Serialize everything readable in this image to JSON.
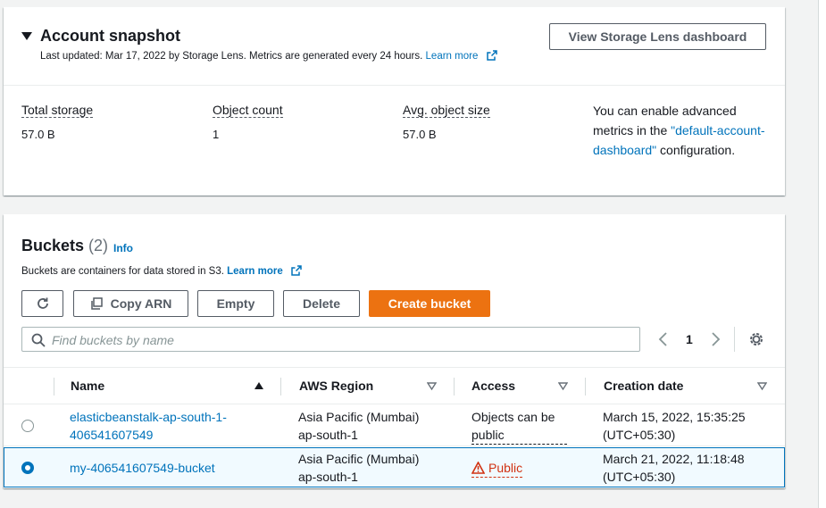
{
  "snapshot": {
    "title": "Account snapshot",
    "subtitle_prefix": "Last updated: Mar 17, 2022 by Storage Lens. Metrics are generated every 24 hours.",
    "learn_more": "Learn more",
    "dashboard_button": "View Storage Lens dashboard",
    "metrics": [
      {
        "label": "Total storage",
        "value": "57.0 B"
      },
      {
        "label": "Object count",
        "value": "1"
      },
      {
        "label": "Avg. object size",
        "value": "57.0 B"
      }
    ],
    "advanced_text_1": "You can enable advanced metrics in the",
    "advanced_link": "\"default-account-dashboard\"",
    "advanced_text_2": "configuration."
  },
  "buckets": {
    "title": "Buckets",
    "count": "(2)",
    "info": "Info",
    "subtitle": "Buckets are containers for data stored in S3.",
    "learn_more": "Learn more",
    "buttons": {
      "copy_arn": "Copy ARN",
      "empty": "Empty",
      "delete": "Delete",
      "create": "Create bucket"
    },
    "search_placeholder": "Find buckets by name",
    "page": "1",
    "columns": [
      "Name",
      "AWS Region",
      "Access",
      "Creation date"
    ],
    "rows": [
      {
        "name_line1": "elasticbeanstalk-ap-south-1-",
        "name_line2": "406541607549",
        "region_line1": "Asia Pacific (Mumbai)",
        "region_line2": "ap-south-1",
        "access_line1": "Objects can be",
        "access_line2": "public",
        "date_line1": "March 15, 2022, 15:35:25",
        "date_line2": "(UTC+05:30)",
        "selected": false
      },
      {
        "name_line1": "my-406541607549-bucket",
        "region_line1": "Asia Pacific (Mumbai)",
        "region_line2": "ap-south-1",
        "access": "Public",
        "date_line1": "March 21, 2022, 11:18:48",
        "date_line2": "(UTC+05:30)",
        "selected": true
      }
    ]
  },
  "colors": {
    "link": "#0073bb",
    "primary_button": "#ec7211",
    "public_warning": "#d13212",
    "selected_row_bg": "#f1faff"
  }
}
